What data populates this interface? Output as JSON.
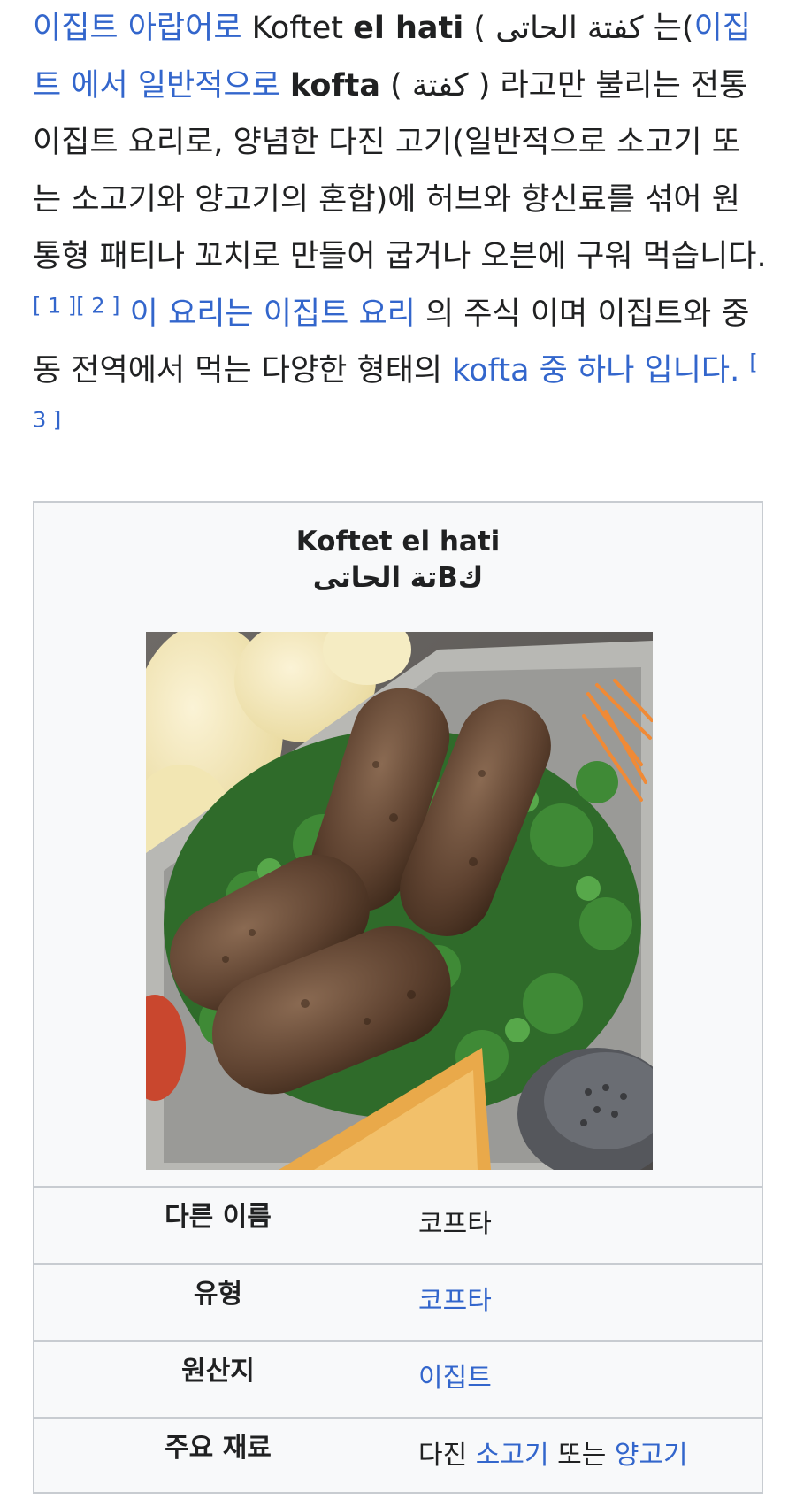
{
  "article": {
    "link_egyptian_arabic": "이집트 아랍어로",
    "text_name": " Koftet ",
    "text_name_bold": "el hati",
    "text_paren_open": " ( ",
    "arabic_1": "كفتة الحاتى",
    "text_neun": " 는(",
    "link_egypt_common": "이집트 에서 일반적으로",
    "text_space": " ",
    "kofta_bold": "kofta",
    "arabic_2_wrapped": " ( كفتة ) ",
    "text_desc": "라고만 불리는 전통 이집트 요리로, 양념한 다진 고기(일반적으로 소고기 또는 소고기와 양고기의 혼합)에 허브와 향신료를 섞어 원통형 패티나 꼬치로 만들어 굽거나 오븐에 구워 먹습니다. ",
    "ref_1": "[ 1 ]",
    "ref_2": "[ 2 ]",
    "link_dish": "이 요리는 이집트 요리",
    "text_staple": " 의 주식 이며 이집트와 중동 전역에서 먹는 다양한 형태의 ",
    "link_kofta_one": "kofta 중 하나 입니다.",
    "ref_3": "[ 3 ]"
  },
  "infobox": {
    "title": "Koftet el hati",
    "subtitle": "كBتة الحاتى",
    "photo_alt": "Koftet el hati photo",
    "rows": [
      {
        "label": "다른 이름",
        "value": "코프타",
        "link": false
      },
      {
        "label": "유형",
        "value": "코프타",
        "link": true
      },
      {
        "label": "원산지",
        "value": "이집트",
        "link": true
      }
    ],
    "ingredients": {
      "label": "주요 재료",
      "prefix": "다진 ",
      "link_beef": "소고기",
      "mid": " 또는 ",
      "link_lamb": "양고기"
    }
  },
  "colors": {
    "link": "#3366cc",
    "border": "#c8ccd1",
    "infobox_bg": "#f8f9fa",
    "text": "#202122"
  }
}
